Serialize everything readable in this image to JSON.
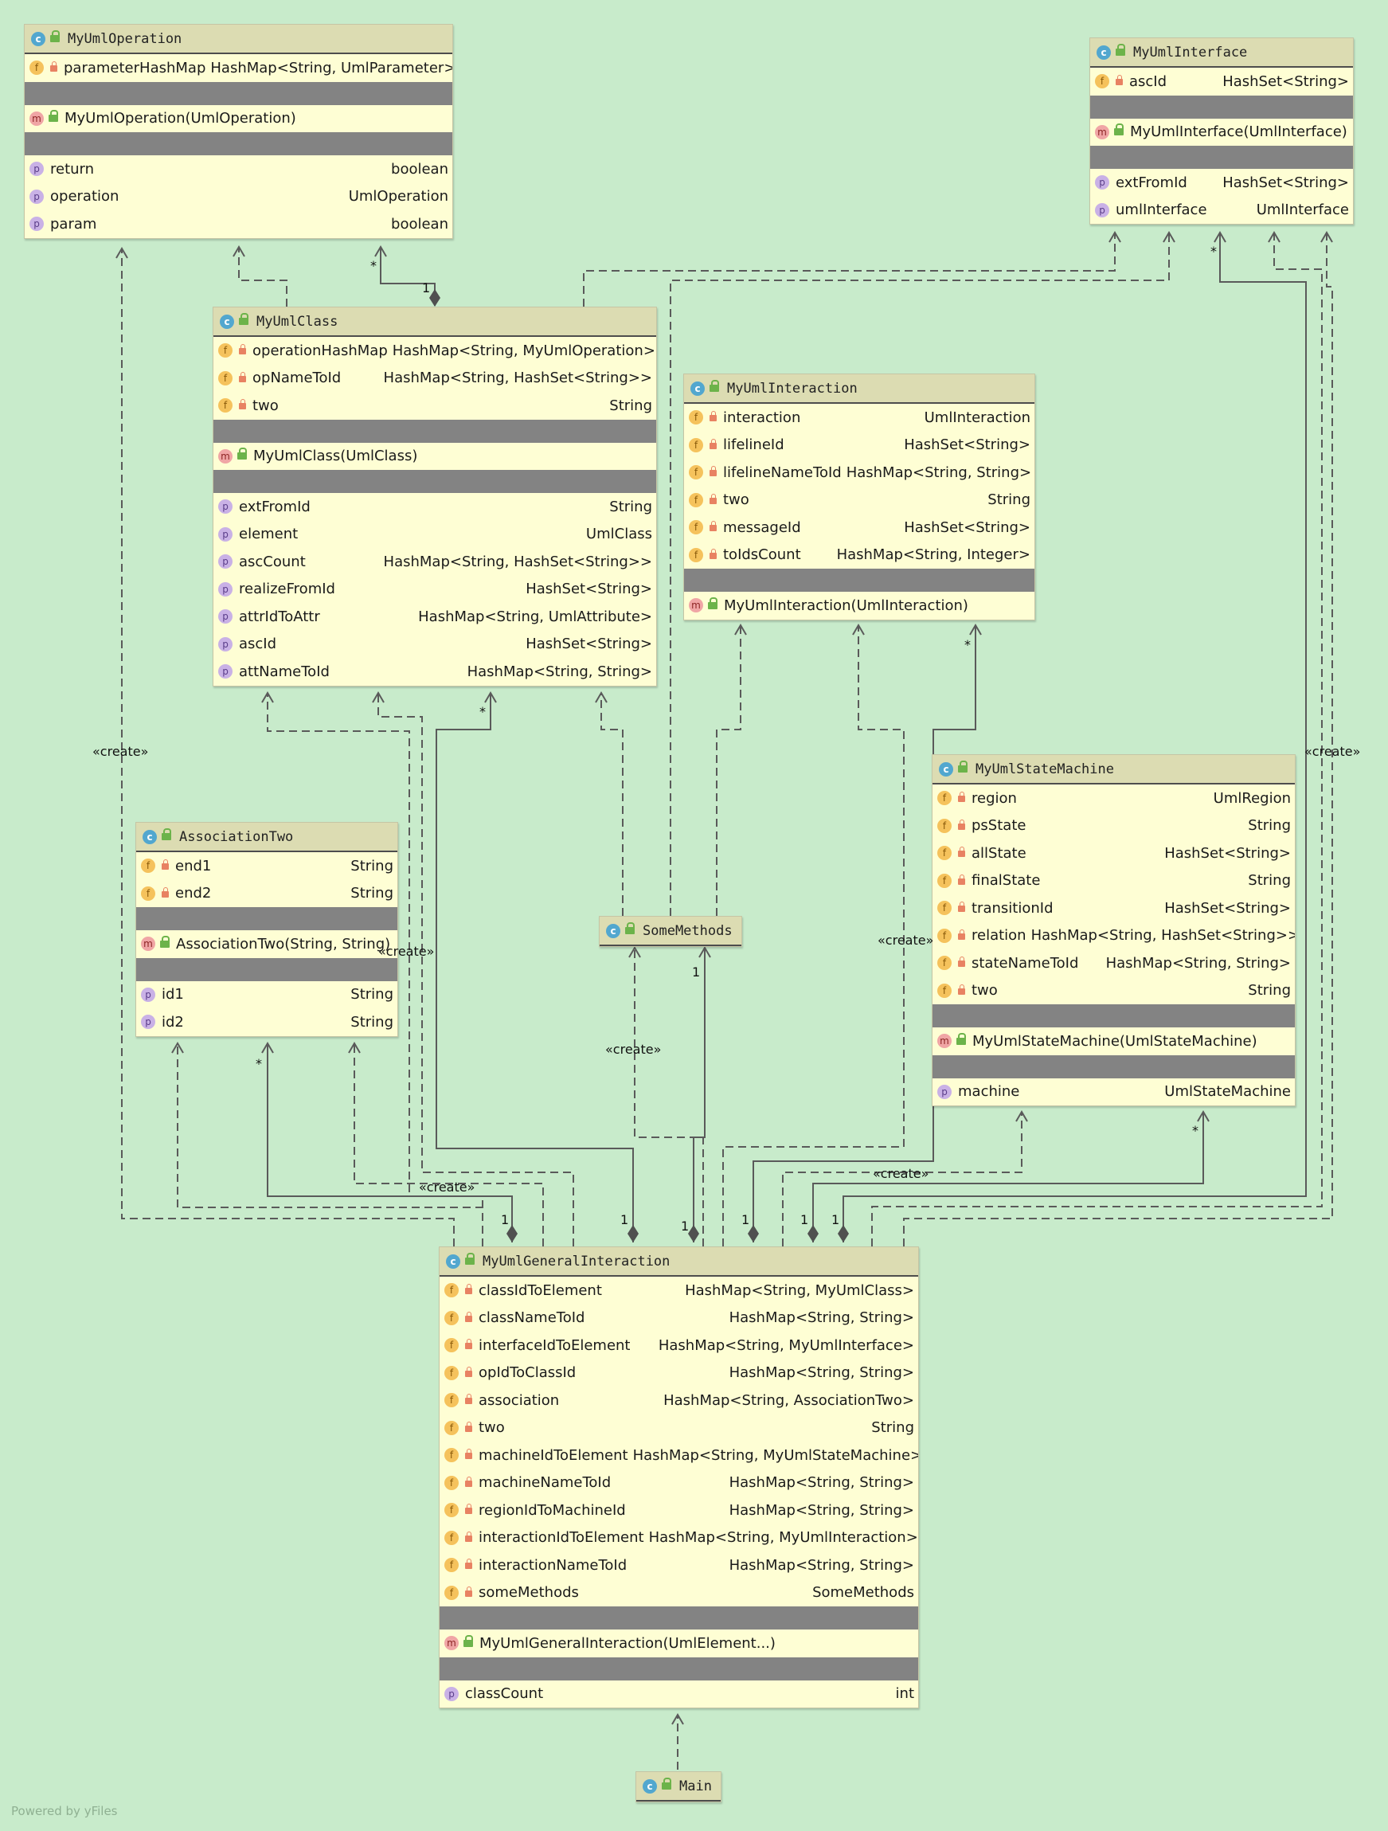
{
  "classes": {
    "op": {
      "name": "MyUmlOperation",
      "fields": [
        {
          "name": "parameterHashMap",
          "type": "HashMap<String, UmlParameter>"
        }
      ],
      "methods": [
        {
          "name": "MyUmlOperation(UmlOperation)"
        }
      ],
      "props": [
        {
          "name": "return",
          "type": "boolean"
        },
        {
          "name": "operation",
          "type": "UmlOperation"
        },
        {
          "name": "param",
          "type": "boolean"
        }
      ]
    },
    "iface": {
      "name": "MyUmlInterface",
      "fields": [
        {
          "name": "ascId",
          "type": "HashSet<String>"
        }
      ],
      "methods": [
        {
          "name": "MyUmlInterface(UmlInterface)"
        }
      ],
      "props": [
        {
          "name": "extFromId",
          "type": "HashSet<String>"
        },
        {
          "name": "umlInterface",
          "type": "UmlInterface"
        }
      ]
    },
    "cls": {
      "name": "MyUmlClass",
      "fields": [
        {
          "name": "operationHashMap",
          "type": "HashMap<String, MyUmlOperation>"
        },
        {
          "name": "opNameToId",
          "type": "HashMap<String, HashSet<String>>"
        },
        {
          "name": "two",
          "type": "String"
        }
      ],
      "methods": [
        {
          "name": "MyUmlClass(UmlClass)"
        }
      ],
      "props": [
        {
          "name": "extFromId",
          "type": "String"
        },
        {
          "name": "element",
          "type": "UmlClass"
        },
        {
          "name": "ascCount",
          "type": "HashMap<String, HashSet<String>>"
        },
        {
          "name": "realizeFromId",
          "type": "HashSet<String>"
        },
        {
          "name": "attrIdToAttr",
          "type": "HashMap<String, UmlAttribute>"
        },
        {
          "name": "ascId",
          "type": "HashSet<String>"
        },
        {
          "name": "attNameToId",
          "type": "HashMap<String, String>"
        }
      ]
    },
    "inter": {
      "name": "MyUmlInteraction",
      "fields": [
        {
          "name": "interaction",
          "type": "UmlInteraction"
        },
        {
          "name": "lifelineId",
          "type": "HashSet<String>"
        },
        {
          "name": "lifelineNameToId",
          "type": "HashMap<String, String>"
        },
        {
          "name": "two",
          "type": "String"
        },
        {
          "name": "messageId",
          "type": "HashSet<String>"
        },
        {
          "name": "toIdsCount",
          "type": "HashMap<String, Integer>"
        }
      ],
      "methods": [
        {
          "name": "MyUmlInteraction(UmlInteraction)"
        }
      ],
      "props": []
    },
    "state": {
      "name": "MyUmlStateMachine",
      "fields": [
        {
          "name": "region",
          "type": "UmlRegion"
        },
        {
          "name": "psState",
          "type": "String"
        },
        {
          "name": "allState",
          "type": "HashSet<String>"
        },
        {
          "name": "finalState",
          "type": "String"
        },
        {
          "name": "transitionId",
          "type": "HashSet<String>"
        },
        {
          "name": "relation",
          "type": "HashMap<String, HashSet<String>>"
        },
        {
          "name": "stateNameToId",
          "type": "HashMap<String, String>"
        },
        {
          "name": "two",
          "type": "String"
        }
      ],
      "methods": [
        {
          "name": "MyUmlStateMachine(UmlStateMachine)"
        }
      ],
      "props": [
        {
          "name": "machine",
          "type": "UmlStateMachine"
        }
      ]
    },
    "assoc": {
      "name": "AssociationTwo",
      "fields": [
        {
          "name": "end1",
          "type": "String"
        },
        {
          "name": "end2",
          "type": "String"
        }
      ],
      "methods": [
        {
          "name": "AssociationTwo(String, String)"
        }
      ],
      "props": [
        {
          "name": "id1",
          "type": "String"
        },
        {
          "name": "id2",
          "type": "String"
        }
      ]
    },
    "some": {
      "name": "SomeMethods",
      "fields": [],
      "methods": [],
      "props": []
    },
    "gen": {
      "name": "MyUmlGeneralInteraction",
      "fields": [
        {
          "name": "classIdToElement",
          "type": "HashMap<String, MyUmlClass>"
        },
        {
          "name": "classNameToId",
          "type": "HashMap<String, String>"
        },
        {
          "name": "interfaceIdToElement",
          "type": "HashMap<String, MyUmlInterface>"
        },
        {
          "name": "opIdToClassId",
          "type": "HashMap<String, String>"
        },
        {
          "name": "association",
          "type": "HashMap<String, AssociationTwo>"
        },
        {
          "name": "two",
          "type": "String"
        },
        {
          "name": "machineIdToElement",
          "type": "HashMap<String, MyUmlStateMachine>"
        },
        {
          "name": "machineNameToId",
          "type": "HashMap<String, String>"
        },
        {
          "name": "regionIdToMachineId",
          "type": "HashMap<String, String>"
        },
        {
          "name": "interactionIdToElement",
          "type": "HashMap<String, MyUmlInteraction>"
        },
        {
          "name": "interactionNameToId",
          "type": "HashMap<String, String>"
        },
        {
          "name": "someMethods",
          "type": "SomeMethods"
        }
      ],
      "methods": [
        {
          "name": "MyUmlGeneralInteraction(UmlElement...)"
        }
      ],
      "props": [
        {
          "name": "classCount",
          "type": "int"
        }
      ]
    },
    "main": {
      "name": "Main",
      "fields": [],
      "methods": [],
      "props": []
    }
  },
  "badges": {
    "class": "c",
    "field": "f",
    "method": "m",
    "property": "p"
  },
  "labels": {
    "create_left": "«create»",
    "create_right": "«create»",
    "create_assoc": "«create»",
    "create_some": "«create»",
    "create_mid": "«create»",
    "create_state": "«create»",
    "create_bottom": "«create»",
    "mult_op_star": "*",
    "mult_op_one": "1",
    "mult_iface_star": "*",
    "mult_cls_star": "*",
    "mult_inter_star": "*",
    "mult_state_star": "*",
    "mult_assoc_star": "*",
    "mult_some_one": "1",
    "g1": "1",
    "g2": "1",
    "g3": "1",
    "g4": "1",
    "g5": "1",
    "g6": "1"
  },
  "footer": "Powered by yFiles",
  "colors": {
    "background": "#c8ebcb",
    "box": "#fefed4",
    "header": "#dcdcb2",
    "separator": "#838383",
    "edge": "#555555"
  }
}
